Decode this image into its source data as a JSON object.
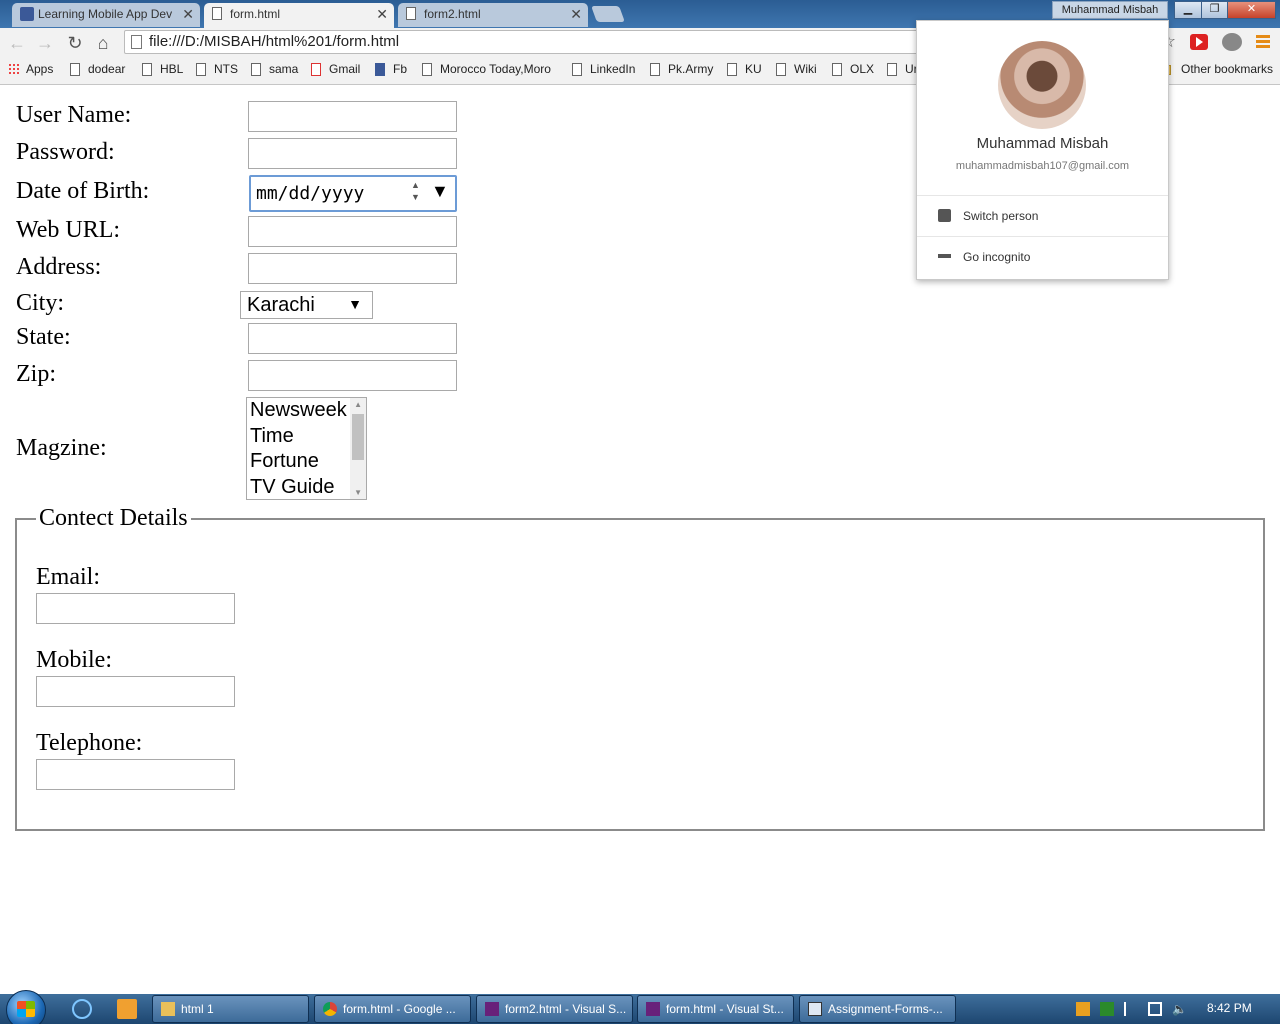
{
  "browser": {
    "tabs": [
      {
        "title": "Learning Mobile App Dev",
        "active": false,
        "icon": "facebook-icon"
      },
      {
        "title": "form.html",
        "active": true,
        "icon": "page-icon"
      },
      {
        "title": "form2.html",
        "active": false,
        "icon": "page-icon"
      }
    ],
    "user_button": "Muhammad Misbah",
    "url": "file:///D:/MISBAH/html%201/form.html",
    "bookmarks": [
      {
        "label": "Apps",
        "icon": "apps-icon"
      },
      {
        "label": "dodear",
        "icon": "page-icon"
      },
      {
        "label": "HBL",
        "icon": "page-icon"
      },
      {
        "label": "NTS",
        "icon": "page-icon"
      },
      {
        "label": "sama",
        "icon": "page-icon"
      },
      {
        "label": "Gmail",
        "icon": "gmail-icon"
      },
      {
        "label": "Fb",
        "icon": "facebook-icon"
      },
      {
        "label": "Morocco Today,Moro",
        "icon": "page-icon"
      },
      {
        "label": "LinkedIn",
        "icon": "page-icon"
      },
      {
        "label": "Pk.Army",
        "icon": "page-icon"
      },
      {
        "label": "KU",
        "icon": "page-icon"
      },
      {
        "label": "Wiki",
        "icon": "page-icon"
      },
      {
        "label": "OLX",
        "icon": "page-icon"
      },
      {
        "label": "Ur",
        "icon": "page-icon"
      }
    ],
    "other_bookmarks": "Other bookmarks"
  },
  "form": {
    "labels": {
      "username": "User Name:",
      "password": "Password:",
      "dob": "Date of Birth:",
      "weburl": "Web URL:",
      "address": "Address:",
      "city": "City:",
      "state": "State:",
      "zip": "Zip:",
      "magazine": "Magzine:"
    },
    "dob_placeholder": "mm/dd/yyyy",
    "city_selected": "Karachi",
    "magazines": [
      "Newsweek",
      "Time",
      "Fortune",
      "TV Guide"
    ]
  },
  "contact": {
    "legend": "Contect Details",
    "email_label": "Email:",
    "mobile_label": "Mobile:",
    "telephone_label": "Telephone:"
  },
  "profile_popup": {
    "name": "Muhammad Misbah",
    "email": "muhammadmisbah107@gmail.com",
    "switch_person": "Switch person",
    "go_incognito": "Go incognito"
  },
  "taskbar": {
    "tasks": [
      {
        "label": "html 1",
        "icon": "folder-icon"
      },
      {
        "label": "form.html - Google ...",
        "icon": "chrome-icon"
      },
      {
        "label": "form2.html - Visual S...",
        "icon": "visual-studio-icon"
      },
      {
        "label": "form.html - Visual St...",
        "icon": "visual-studio-icon"
      },
      {
        "label": "Assignment-Forms-...",
        "icon": "window-icon"
      }
    ],
    "clock": "8:42 PM"
  },
  "colors": {
    "titlebar": "#2b5d93",
    "date_focus_border": "#6c9bd6",
    "menu_orange": "#e58b16"
  }
}
